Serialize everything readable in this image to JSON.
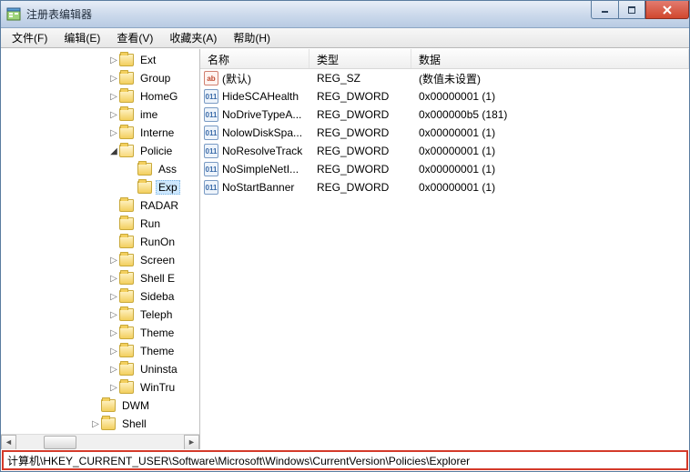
{
  "window": {
    "title": "注册表编辑器"
  },
  "menu": {
    "file": "文件(F)",
    "edit": "编辑(E)",
    "view": "查看(V)",
    "fav": "收藏夹(A)",
    "help": "帮助(H)"
  },
  "tree": [
    {
      "indent": 118,
      "tri": "closed",
      "name": "Ext"
    },
    {
      "indent": 118,
      "tri": "closed",
      "name": "Group"
    },
    {
      "indent": 118,
      "tri": "closed",
      "name": "HomeG"
    },
    {
      "indent": 118,
      "tri": "closed",
      "name": "ime"
    },
    {
      "indent": 118,
      "tri": "closed",
      "name": "Interne"
    },
    {
      "indent": 118,
      "tri": "open",
      "name": "Policie",
      "open": true
    },
    {
      "indent": 138,
      "tri": "none",
      "name": "Ass"
    },
    {
      "indent": 138,
      "tri": "none",
      "name": "Exp",
      "selected": true
    },
    {
      "indent": 118,
      "tri": "none",
      "name": "RADAR"
    },
    {
      "indent": 118,
      "tri": "none",
      "name": "Run"
    },
    {
      "indent": 118,
      "tri": "none",
      "name": "RunOn"
    },
    {
      "indent": 118,
      "tri": "closed",
      "name": "Screen"
    },
    {
      "indent": 118,
      "tri": "closed",
      "name": "Shell E"
    },
    {
      "indent": 118,
      "tri": "closed",
      "name": "Sideba"
    },
    {
      "indent": 118,
      "tri": "closed",
      "name": "Teleph"
    },
    {
      "indent": 118,
      "tri": "closed",
      "name": "Theme"
    },
    {
      "indent": 118,
      "tri": "closed",
      "name": "Theme"
    },
    {
      "indent": 118,
      "tri": "closed",
      "name": "Uninsta"
    },
    {
      "indent": 118,
      "tri": "closed",
      "name": "WinTru"
    },
    {
      "indent": 98,
      "tri": "none",
      "name": "DWM"
    },
    {
      "indent": 98,
      "tri": "closed",
      "name": "Shell"
    }
  ],
  "columns": {
    "name": "名称",
    "type": "类型",
    "data": "数据"
  },
  "values": [
    {
      "icon": "str",
      "name": "(默认)",
      "type": "REG_SZ",
      "data": "(数值未设置)"
    },
    {
      "icon": "dw",
      "name": "HideSCAHealth",
      "type": "REG_DWORD",
      "data": "0x00000001 (1)"
    },
    {
      "icon": "dw",
      "name": "NoDriveTypeA...",
      "type": "REG_DWORD",
      "data": "0x000000b5 (181)"
    },
    {
      "icon": "dw",
      "name": "NolowDiskSpa...",
      "type": "REG_DWORD",
      "data": "0x00000001 (1)"
    },
    {
      "icon": "dw",
      "name": "NoResolveTrack",
      "type": "REG_DWORD",
      "data": "0x00000001 (1)"
    },
    {
      "icon": "dw",
      "name": "NoSimpleNetI...",
      "type": "REG_DWORD",
      "data": "0x00000001 (1)"
    },
    {
      "icon": "dw",
      "name": "NoStartBanner",
      "type": "REG_DWORD",
      "data": "0x00000001 (1)"
    }
  ],
  "statusbar": {
    "path": "计算机\\HKEY_CURRENT_USER\\Software\\Microsoft\\Windows\\CurrentVersion\\Policies\\Explorer"
  },
  "icons": {
    "str_label": "ab",
    "dw_label": "011"
  }
}
